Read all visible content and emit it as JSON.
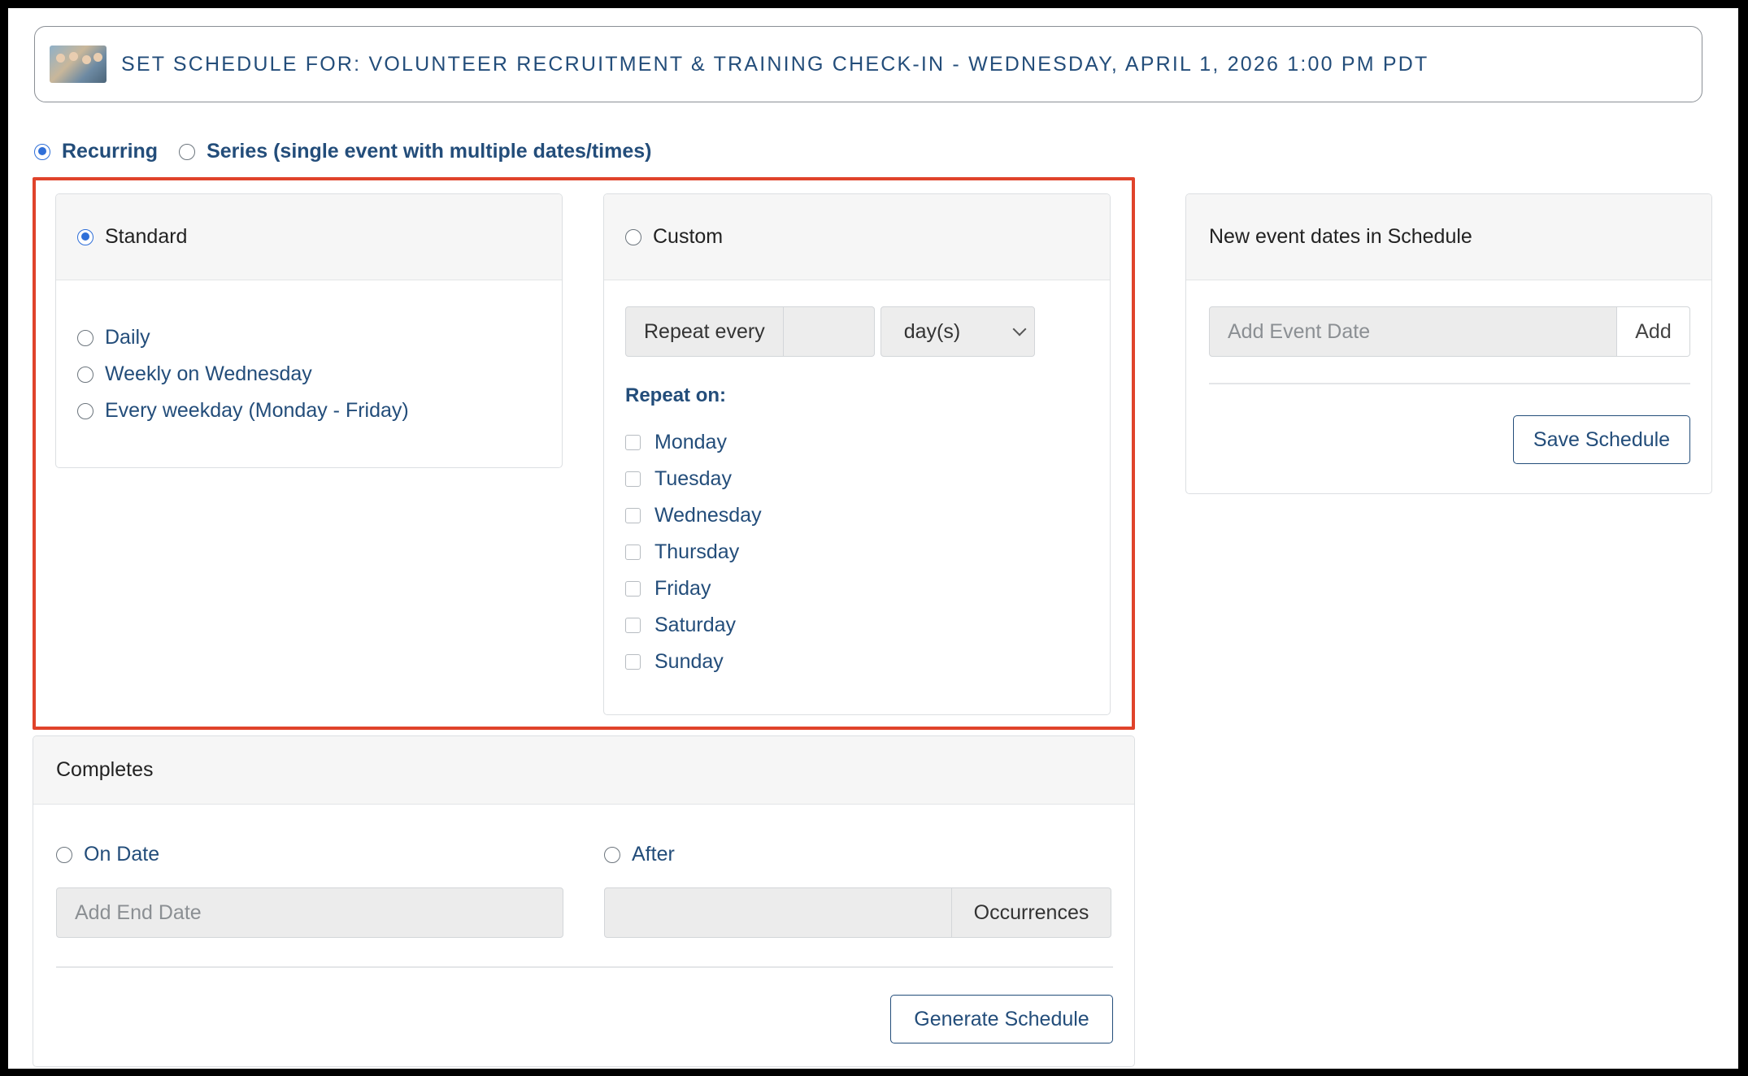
{
  "header": {
    "thumbnail_icon": "event-photo-thumbnail",
    "title": "SET SCHEDULE FOR: VOLUNTEER RECRUITMENT & TRAINING CHECK-IN - WEDNESDAY, APRIL 1, 2026 1:00 PM PDT"
  },
  "mode": {
    "recurring_label": "Recurring",
    "series_label": "Series (single event with multiple dates/times)",
    "selected": "recurring"
  },
  "standard": {
    "label": "Standard",
    "selected": true,
    "options": [
      "Daily",
      "Weekly on Wednesday",
      "Every weekday (Monday - Friday)"
    ]
  },
  "custom": {
    "label": "Custom",
    "repeat_every_label": "Repeat every",
    "repeat_every_value": "",
    "unit_selected": "day(s)",
    "repeat_on_label": "Repeat on:",
    "days": [
      "Monday",
      "Tuesday",
      "Wednesday",
      "Thursday",
      "Friday",
      "Saturday",
      "Sunday"
    ]
  },
  "new_dates": {
    "title": "New event dates in Schedule",
    "input_placeholder": "Add Event Date",
    "add_label": "Add",
    "save_label": "Save Schedule"
  },
  "completes": {
    "title": "Completes",
    "on_date_label": "On Date",
    "end_date_placeholder": "Add End Date",
    "after_label": "After",
    "occurrences_value": "",
    "occurrences_label": "Occurrences",
    "generate_label": "Generate Schedule"
  },
  "colors": {
    "accent": "#234d7a",
    "radio_selected": "#2f6fd8",
    "highlight_border": "#e0432b"
  }
}
